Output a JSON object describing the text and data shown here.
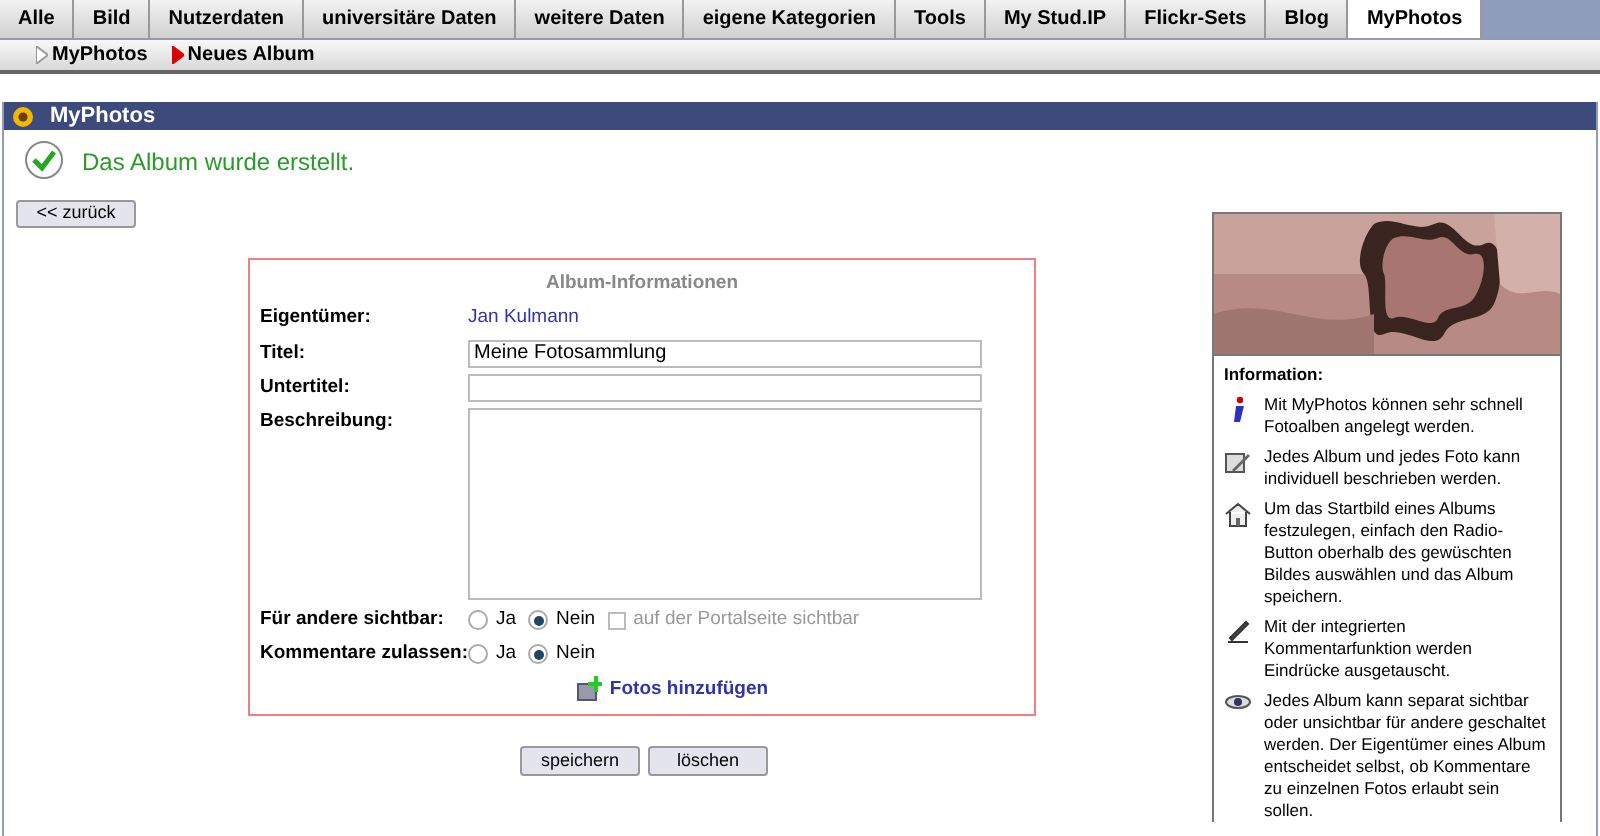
{
  "tabs": [
    {
      "label": "Alle",
      "selected": false
    },
    {
      "label": "Bild",
      "selected": false
    },
    {
      "label": "Nutzerdaten",
      "selected": false
    },
    {
      "label": "universitäre Daten",
      "selected": false
    },
    {
      "label": "weitere Daten",
      "selected": false
    },
    {
      "label": "eigene Kategorien",
      "selected": false
    },
    {
      "label": "Tools",
      "selected": false
    },
    {
      "label": "My Stud.IP",
      "selected": false
    },
    {
      "label": "Flickr-Sets",
      "selected": false
    },
    {
      "label": "Blog",
      "selected": false
    },
    {
      "label": "MyPhotos",
      "selected": true
    }
  ],
  "subnav": [
    {
      "label": "MyPhotos",
      "selected": false
    },
    {
      "label": "Neues Album",
      "selected": true
    }
  ],
  "header": {
    "title": "MyPhotos"
  },
  "message": "Das Album wurde erstellt.",
  "back_button": "<< zurück",
  "form": {
    "title": "Album-Informationen",
    "owner": {
      "label": "Eigentümer:",
      "value": "Jan Kulmann"
    },
    "title_field": {
      "label": "Titel:",
      "value": "Meine Fotosammlung"
    },
    "subtitle_field": {
      "label": "Untertitel:"
    },
    "description_field": {
      "label": "Beschreibung:"
    },
    "radios": [
      {
        "label": "Für andere sichtbar:",
        "options": [
          {
            "label": "Ja",
            "selected": false
          },
          {
            "label": "Nein",
            "selected": true
          }
        ],
        "extra": {
          "label": "auf der Portalseite sichtbar",
          "checked": false,
          "disabled": true
        }
      },
      {
        "label": "Kommentare zulassen:",
        "options": [
          {
            "label": "Ja",
            "selected": false
          },
          {
            "label": "Nein",
            "selected": true
          }
        ]
      }
    ],
    "add_link": "Fotos hinzufügen"
  },
  "buttons": [
    "speichern",
    "löschen"
  ],
  "sidebar": {
    "heading": "Information:",
    "items": [
      {
        "kind": "info",
        "text": "Mit MyPhotos können sehr schnell Fotoalben angelegt werden."
      },
      {
        "kind": "edit",
        "text": "Jedes Album und jedes Foto kann individuell beschrieben werden."
      },
      {
        "kind": "home",
        "text": "Um das Startbild eines Albums festzulegen, einfach den Radio-Button oberhalb des gewüschten Bildes auswählen und das Album speichern."
      },
      {
        "kind": "comment",
        "text": "Mit der integrierten Kommentarfunktion werden Eindrücke ausgetauscht."
      },
      {
        "kind": "eye",
        "text": "Jedes Album kann separat sichtbar oder unsichtbar für andere geschaltet werden. Der Eigentümer eines Album entscheidet selbst, ob Kommentare zu einzelnen Fotos erlaubt sein sollen."
      }
    ]
  }
}
